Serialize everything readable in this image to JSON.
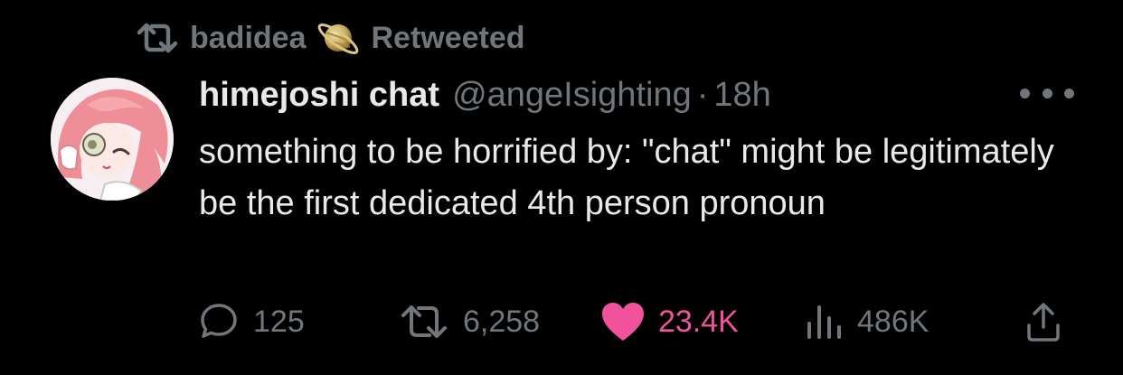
{
  "retweet": {
    "user": "badidea",
    "label": "Retweeted",
    "badge_icon": "saturn-planet-icon"
  },
  "tweet": {
    "display_name": "himejoshi chat",
    "handle": "@angeIsighting",
    "separator": "·",
    "time": "18h",
    "text": "something to be horrified by: \"chat\" might be legitimately be the first dedicated 4th person pronoun",
    "more_icon": "more-options-icon"
  },
  "actions": {
    "replies": "125",
    "retweets": "6,258",
    "likes": "23.4K",
    "views": "486K"
  },
  "colors": {
    "background": "#000000",
    "text": "#e7e9ea",
    "secondary": "#71767b",
    "like_active": "#f0529c"
  }
}
